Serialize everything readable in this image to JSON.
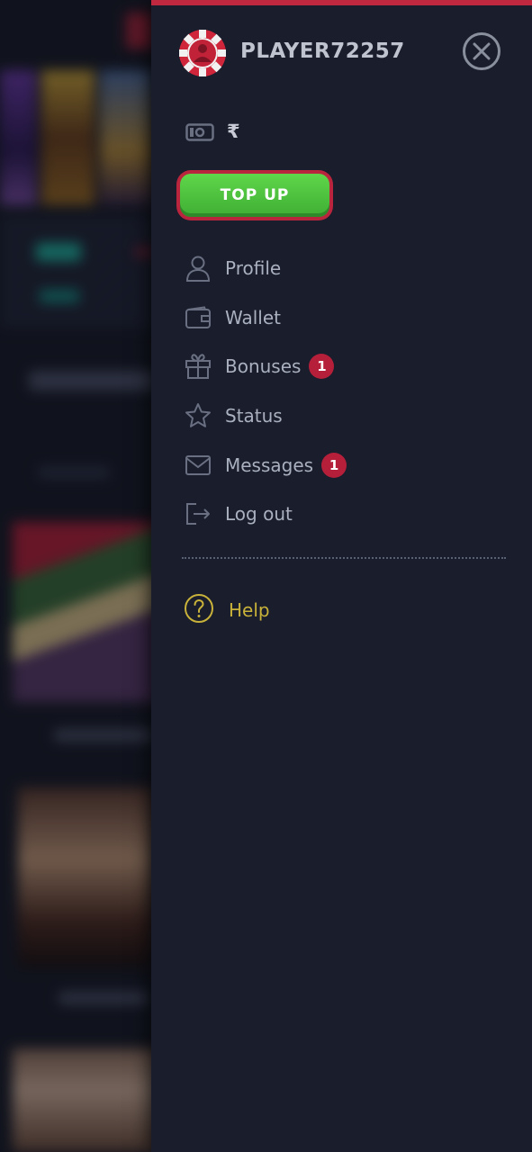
{
  "user": {
    "username": "PLAYER72257"
  },
  "balance": {
    "currency_symbol": "₹"
  },
  "actions": {
    "top_up_label": "TOP UP"
  },
  "menu": {
    "items": [
      {
        "id": "profile",
        "label": "Profile",
        "icon": "user-icon"
      },
      {
        "id": "wallet",
        "label": "Wallet",
        "icon": "wallet-icon"
      },
      {
        "id": "bonuses",
        "label": "Bonuses",
        "icon": "gift-icon",
        "badge": "1"
      },
      {
        "id": "status",
        "label": "Status",
        "icon": "star-icon"
      },
      {
        "id": "messages",
        "label": "Messages",
        "icon": "envelope-icon",
        "badge": "1"
      },
      {
        "id": "logout",
        "label": "Log out",
        "icon": "logout-icon"
      }
    ]
  },
  "help": {
    "label": "Help",
    "icon": "question-circle-icon"
  },
  "colors": {
    "accent_red": "#c0283f",
    "top_up_green": "#4cc23e",
    "badge_red": "#b51f3a",
    "help_gold": "#c9b23a",
    "drawer_bg": "#191d2c"
  }
}
